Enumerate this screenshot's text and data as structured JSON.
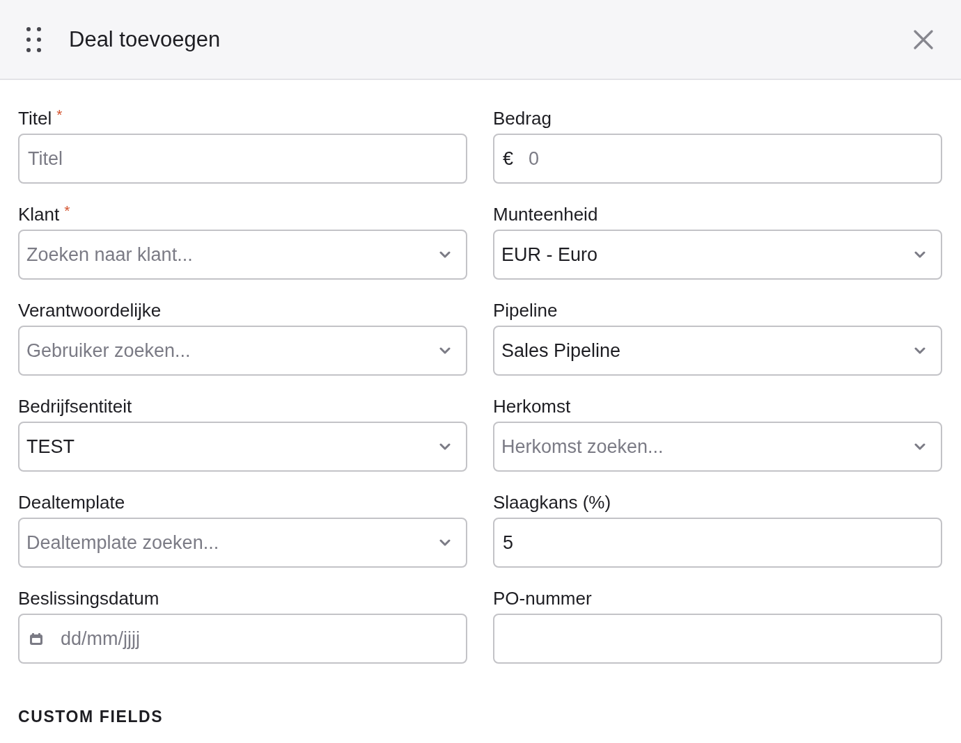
{
  "dialog": {
    "title": "Deal toevoegen"
  },
  "fields": [
    {
      "label": "Titel",
      "required_mark": "*",
      "kind": "text",
      "placeholder": "Titel"
    },
    {
      "label": "Bedrag",
      "kind": "currency",
      "prefix": "€",
      "placeholder": "0"
    },
    {
      "label": "Klant",
      "required_mark": "*",
      "kind": "select",
      "placeholder": "Zoeken naar klant..."
    },
    {
      "label": "Munteenheid",
      "kind": "select",
      "value": "EUR - Euro"
    },
    {
      "label": "Verantwoordelijke",
      "kind": "select",
      "placeholder": "Gebruiker zoeken..."
    },
    {
      "label": "Pipeline",
      "kind": "select",
      "value": "Sales Pipeline"
    },
    {
      "label": "Bedrijfsentiteit",
      "kind": "select",
      "value": "TEST"
    },
    {
      "label": "Herkomst",
      "kind": "select",
      "placeholder": "Herkomst zoeken..."
    },
    {
      "label": "Dealtemplate",
      "kind": "select",
      "placeholder": "Dealtemplate zoeken..."
    },
    {
      "label": "Slaagkans (%)",
      "kind": "text",
      "value": "5"
    },
    {
      "label": "Beslissingsdatum",
      "kind": "date",
      "placeholder": "dd/mm/jjjj"
    },
    {
      "label": "PO-nummer",
      "kind": "text"
    }
  ],
  "section": {
    "title": "CUSTOM FIELDS"
  }
}
